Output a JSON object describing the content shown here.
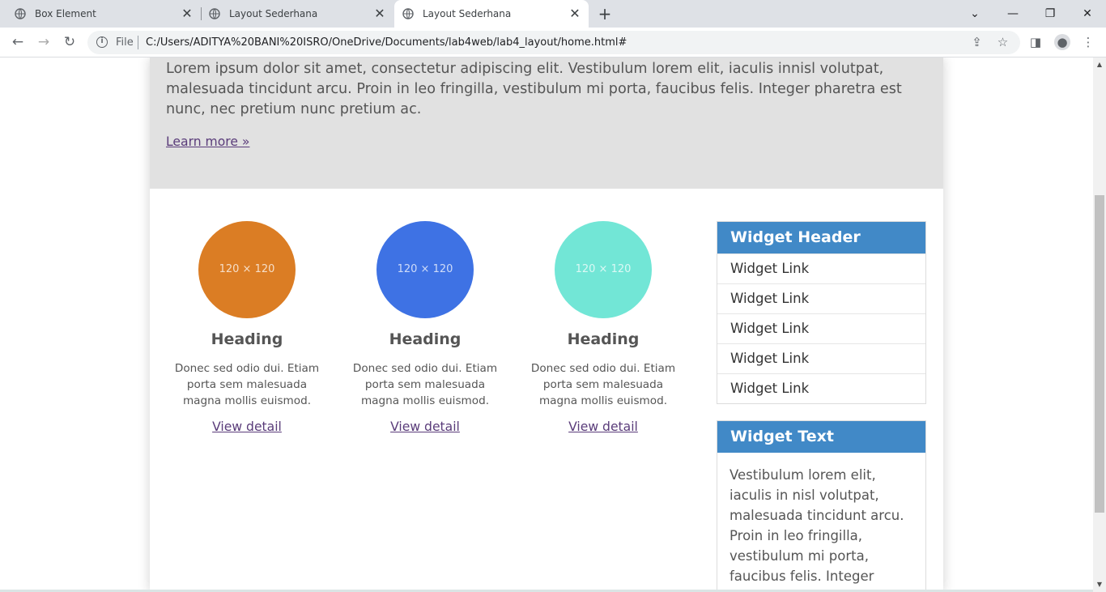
{
  "browser": {
    "tabs": [
      {
        "title": "Box Element",
        "active": false
      },
      {
        "title": "Layout Sederhana",
        "active": false
      },
      {
        "title": "Layout Sederhana",
        "active": true
      }
    ],
    "omnibox": {
      "scheme_label": "File",
      "url": "C:/Users/ADITYA%20BANI%20ISRO/OneDrive/Documents/lab4web/lab4_layout/home.html#"
    }
  },
  "page": {
    "jumbotron": {
      "text": "Lorem ipsum dolor sit amet, consectetur adipiscing elit. Vestibulum lorem elit, iaculis innisl volutpat, malesuada tincidunt arcu. Proin in leo fringilla, vestibulum mi porta, faucibus felis. Integer pharetra est nunc, nec pretium nunc pretium ac.",
      "link": "Learn more »"
    },
    "columns": [
      {
        "image_label": "120 × 120",
        "color": "#db7d24",
        "heading": "Heading",
        "text": "Donec sed odio dui. Etiam porta sem malesuada magna mollis euismod.",
        "link": "View detail"
      },
      {
        "image_label": "120 × 120",
        "color": "#3e72e4",
        "heading": "Heading",
        "text": "Donec sed odio dui. Etiam porta sem malesuada magna mollis euismod.",
        "link": "View detail"
      },
      {
        "image_label": "120 × 120",
        "color": "#72e6d6",
        "heading": "Heading",
        "text": "Donec sed odio dui. Etiam porta sem malesuada magna mollis euismod.",
        "link": "View detail"
      }
    ],
    "widget_links": {
      "header": "Widget Header",
      "links": [
        "Widget Link",
        "Widget Link",
        "Widget Link",
        "Widget Link",
        "Widget Link"
      ]
    },
    "widget_text": {
      "header": "Widget Text",
      "text": "Vestibulum lorem elit, iaculis in nisl volutpat, malesuada tincidunt arcu. Proin in leo fringilla, vestibulum mi porta, faucibus felis. Integer pharetra est nunc, nec"
    }
  },
  "colors": {
    "widget_header": "#4189c7",
    "jumbotron_bg": "#e1e1e1",
    "link": "#5a3c7a"
  }
}
